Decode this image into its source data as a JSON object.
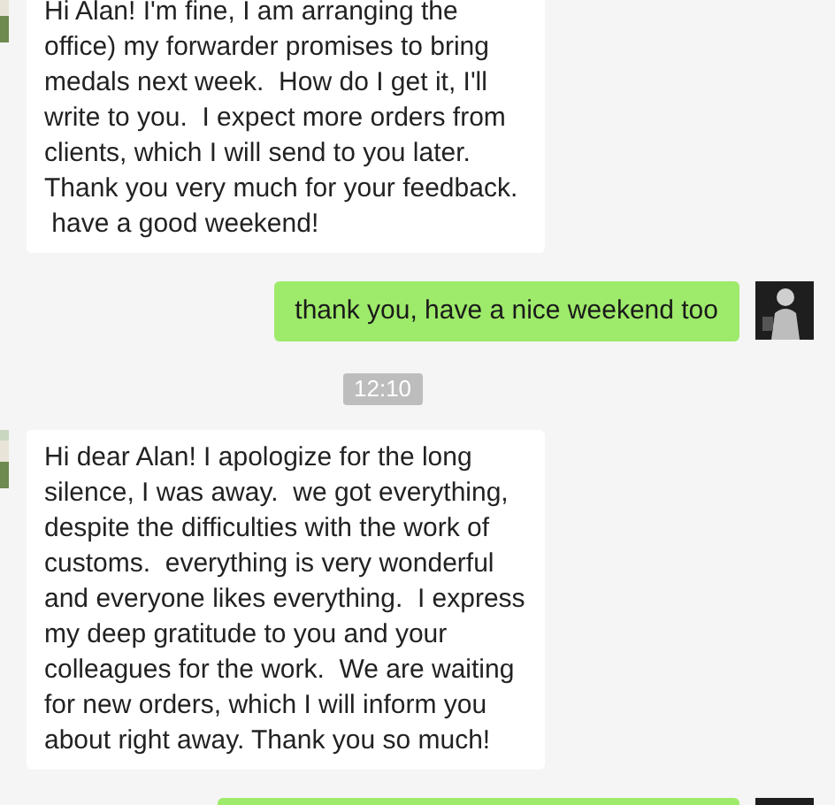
{
  "messages": [
    {
      "kind": "received",
      "text": "Hi Alan! I'm fine, I am arranging the\noffice) my forwarder promises to bring\nmedals next week.  How do I get it, I'll\nwrite to you.  I expect more orders from\nclients, which I will send to you later.\nThank you very much for your feedback.\n have a good weekend!"
    },
    {
      "kind": "sent",
      "text": "thank you, have a nice weekend too"
    },
    {
      "kind": "time",
      "text": "12:10"
    },
    {
      "kind": "received",
      "text": "Hi dear Alan! I apologize for the long\nsilence, I was away.  we got everything,\ndespite the difficulties with the work of\ncustoms.  everything is very wonderful\nand everyone likes everything.  I express\nmy deep gratitude to you and your\ncolleagues for the work.  We are waiting\nfor new orders, which I will inform you\nabout right away. Thank you so much!"
    },
    {
      "kind": "sent"
    }
  ]
}
